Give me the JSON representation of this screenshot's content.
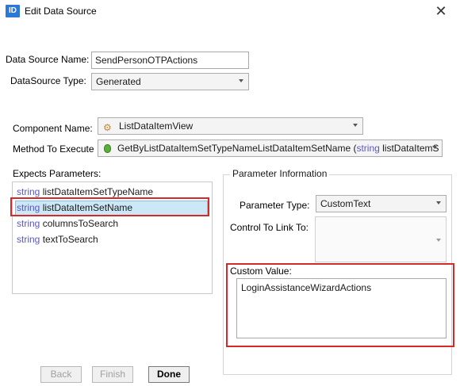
{
  "window": {
    "app_icon_text": "ID",
    "title": "Edit Data Source",
    "close_glyph": "✕"
  },
  "form": {
    "data_source_name_label": "Data Source Name:",
    "data_source_name_value": "SendPersonOTPActions",
    "data_source_type_label": "DataSource Type:",
    "data_source_type_value": "Generated",
    "component_name_label": "Component Name:",
    "component_name_value": "ListDataItemView",
    "method_label": "Method To Execute",
    "method_value": "GetByListDataItemSetTypeNameListDataItemSetName (",
    "method_value_kw": "string",
    "method_value_tail": " listDataItemS"
  },
  "params": {
    "label": "Expects Parameters:",
    "items": [
      {
        "type": "string",
        "name": "listDataItemSetTypeName"
      },
      {
        "type": "string",
        "name": "listDataItemSetName"
      },
      {
        "type": "string",
        "name": "columnsToSearch"
      },
      {
        "type": "string",
        "name": "textToSearch"
      }
    ],
    "selected_index": 1
  },
  "param_info": {
    "group_title": "Parameter Information",
    "type_label": "Parameter Type:",
    "type_value": "CustomText",
    "control_label": "Control To Link To:",
    "custom_value_label": "Custom Value:",
    "custom_value": "LoginAssistanceWizardActions"
  },
  "buttons": {
    "back": "Back",
    "finish": "Finish",
    "done": "Done"
  },
  "icons": {
    "app": "id-app-icon",
    "component": "component-icon",
    "method": "method-gem-icon",
    "dropdown": "chevron-down-icon"
  },
  "colors": {
    "highlight_border": "#d42a2a",
    "selection_fill": "#cce8f6",
    "keyword": "#5a5aba"
  }
}
